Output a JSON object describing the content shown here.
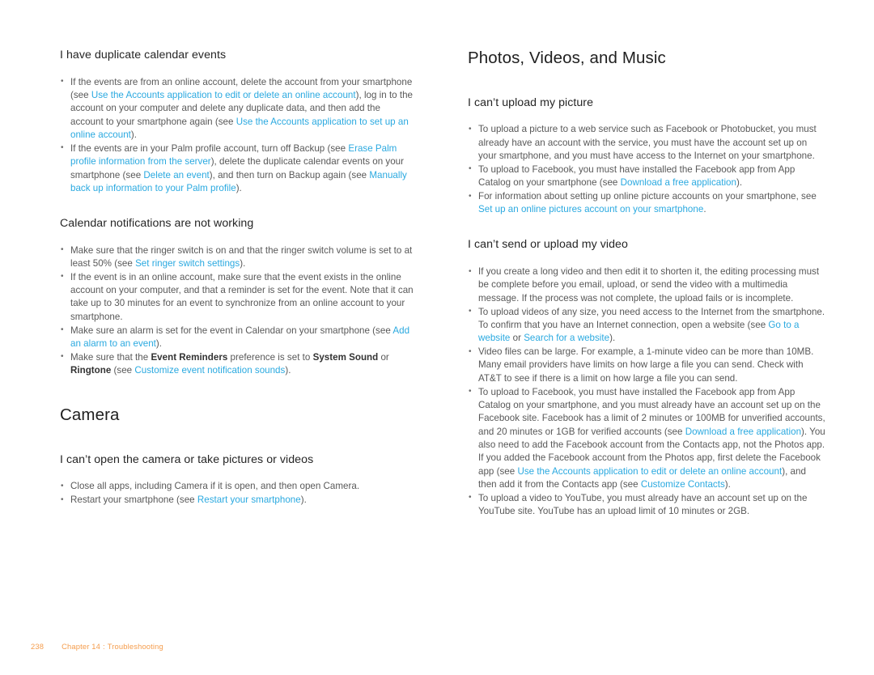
{
  "document": {
    "type": "user-guide-page",
    "colors": {
      "link": "#2aa9e0",
      "body_text": "#585858",
      "heading": "#1f1f1f",
      "footer": "#f59d4d",
      "background": "#ffffff"
    }
  },
  "left_column": {
    "sections": [
      {
        "heading": "I have duplicate calendar events",
        "heading_level": 2,
        "bullets": [
          [
            {
              "t": "text",
              "v": "If the events are from an online account, delete the account from your smartphone (see "
            },
            {
              "t": "link",
              "v": "Use the Accounts application to edit or delete an online account"
            },
            {
              "t": "text",
              "v": "), log in to the account on your computer and delete any duplicate data, and then add the account to your smartphone again (see "
            },
            {
              "t": "link",
              "v": "Use the Accounts application to set up an online account"
            },
            {
              "t": "text",
              "v": ")."
            }
          ],
          [
            {
              "t": "text",
              "v": "If the events are in your Palm profile account, turn off Backup (see "
            },
            {
              "t": "link",
              "v": "Erase Palm profile information from the server"
            },
            {
              "t": "text",
              "v": "), delete the duplicate calendar events on your smartphone (see "
            },
            {
              "t": "link",
              "v": "Delete an event"
            },
            {
              "t": "text",
              "v": "), and then turn on Backup again (see "
            },
            {
              "t": "link",
              "v": "Manually back up information to your Palm profile"
            },
            {
              "t": "text",
              "v": ")."
            }
          ]
        ]
      },
      {
        "heading": "Calendar notifications are not working",
        "heading_level": 2,
        "bullets": [
          [
            {
              "t": "text",
              "v": "Make sure that the ringer switch is on and that the ringer switch volume is set to at least 50% (see "
            },
            {
              "t": "link",
              "v": "Set ringer switch settings"
            },
            {
              "t": "text",
              "v": ")."
            }
          ],
          [
            {
              "t": "text",
              "v": "If the event is in an online account, make sure that the event exists in the online account on your computer, and that a reminder is set for the event. Note that it can take up to 30 minutes for an event to synchronize from an online account to your smartphone."
            }
          ],
          [
            {
              "t": "text",
              "v": "Make sure an alarm is set for the event in Calendar on your smartphone (see "
            },
            {
              "t": "link",
              "v": "Add an alarm to an event"
            },
            {
              "t": "text",
              "v": ")."
            }
          ],
          [
            {
              "t": "text",
              "v": "Make sure that the "
            },
            {
              "t": "bold",
              "v": "Event Reminders"
            },
            {
              "t": "text",
              "v": " preference is set to "
            },
            {
              "t": "bold",
              "v": "System Sound"
            },
            {
              "t": "text",
              "v": " or "
            },
            {
              "t": "bold",
              "v": "Ringtone"
            },
            {
              "t": "text",
              "v": " (see "
            },
            {
              "t": "link",
              "v": "Customize event notification sounds"
            },
            {
              "t": "text",
              "v": ")."
            }
          ]
        ]
      },
      {
        "heading": "Camera",
        "heading_level": 1,
        "bullets": []
      },
      {
        "heading": "I can’t open the camera or take pictures or videos",
        "heading_level": 2,
        "bullets": [
          [
            {
              "t": "text",
              "v": "Close all apps, including Camera if it is open, and then open Camera."
            }
          ],
          [
            {
              "t": "text",
              "v": "Restart your smartphone (see "
            },
            {
              "t": "link",
              "v": "Restart your smartphone"
            },
            {
              "t": "text",
              "v": ")."
            }
          ]
        ]
      }
    ]
  },
  "right_column": {
    "sections": [
      {
        "heading": "Photos, Videos, and Music",
        "heading_level": 1,
        "bullets": []
      },
      {
        "heading": "I can’t upload my picture",
        "heading_level": 2,
        "bullets": [
          [
            {
              "t": "text",
              "v": "To upload a picture to a web service such as Facebook or Photobucket, you must already have an account with the service, you must have the account set up on your smartphone, and you must have access to the Internet on your smartphone."
            }
          ],
          [
            {
              "t": "text",
              "v": "To upload to Facebook, you must have installed the Facebook app from App Catalog on your smartphone (see "
            },
            {
              "t": "link",
              "v": "Download a free application"
            },
            {
              "t": "text",
              "v": ")."
            }
          ],
          [
            {
              "t": "text",
              "v": "For information about setting up online picture accounts on your smartphone, see "
            },
            {
              "t": "link",
              "v": "Set up an online pictures account on your smartphone"
            },
            {
              "t": "text",
              "v": "."
            }
          ]
        ]
      },
      {
        "heading": "I can’t send or upload my video",
        "heading_level": 2,
        "bullets": [
          [
            {
              "t": "text",
              "v": "If you create a long video and then edit it to shorten it, the editing processing must be complete before you email, upload, or send the video with a multimedia message. If the process was not complete, the upload fails or is incomplete."
            }
          ],
          [
            {
              "t": "text",
              "v": "To upload videos of any size, you need access to the Internet from the smartphone. To confirm that you have an Internet connection, open a website (see "
            },
            {
              "t": "link",
              "v": "Go to a website"
            },
            {
              "t": "text",
              "v": " or "
            },
            {
              "t": "link",
              "v": "Search for a website"
            },
            {
              "t": "text",
              "v": ")."
            }
          ],
          [
            {
              "t": "text",
              "v": "Video files can be large. For example, a 1-minute video can be more than 10MB. Many email providers have limits on how large a file you can send. Check with AT&T to see if there is a limit on how large a file you can send."
            }
          ],
          [
            {
              "t": "text",
              "v": "To upload to Facebook, you must have installed the Facebook app from App Catalog on your smartphone, and you must already have an account set up on the Facebook site. Facebook has a limit of 2 minutes or 100MB for unverified accounts, and 20 minutes or 1GB for verified accounts (see "
            },
            {
              "t": "link",
              "v": "Download a free application"
            },
            {
              "t": "text",
              "v": "). You also need to add the Facebook account from the Contacts app, not the Photos app. If you added the Facebook account from the Photos app, first delete the Facebook app (see "
            },
            {
              "t": "link",
              "v": "Use the Accounts application to edit or delete an online account"
            },
            {
              "t": "text",
              "v": "), and then add it from the Contacts app (see "
            },
            {
              "t": "link",
              "v": "Customize Contacts"
            },
            {
              "t": "text",
              "v": ")."
            }
          ],
          [
            {
              "t": "text",
              "v": "To upload a video to YouTube, you must already have an account set up on the YouTube site. YouTube has an upload limit of 10 minutes or 2GB."
            }
          ]
        ]
      }
    ]
  },
  "footer": {
    "page_number": "238",
    "chapter": "Chapter 14",
    "separator": ":",
    "chapter_title": "Troubleshooting"
  }
}
